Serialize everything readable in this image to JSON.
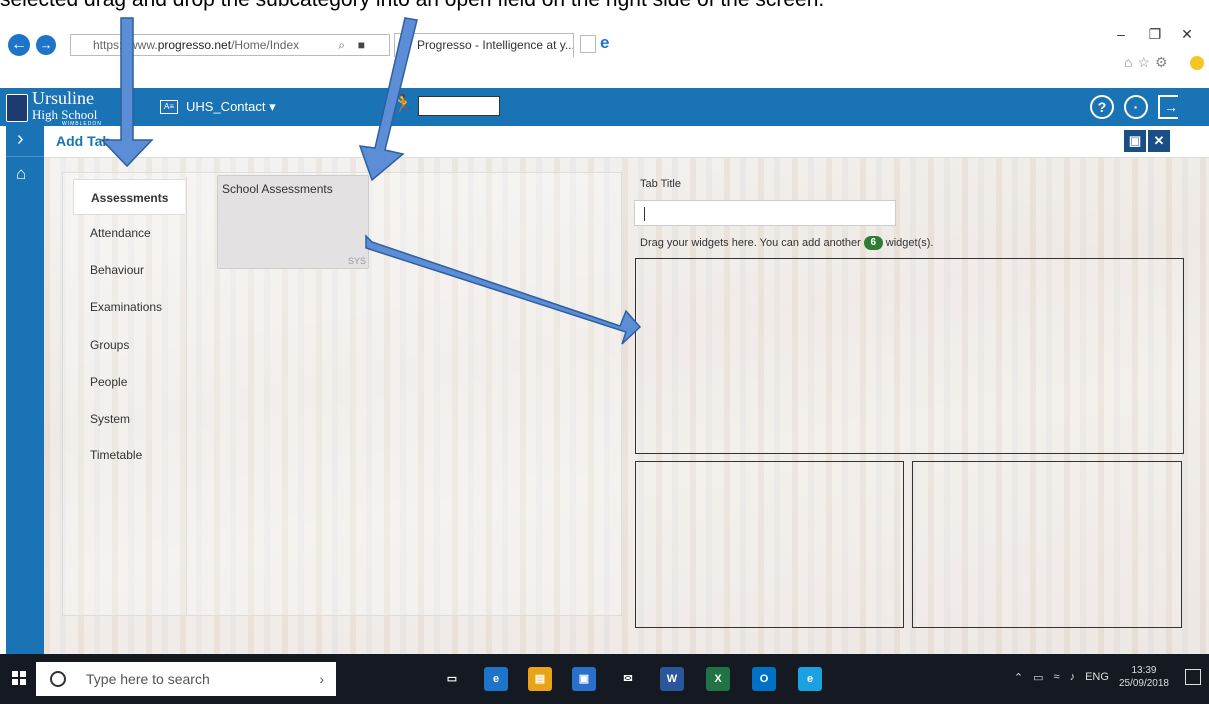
{
  "caption": "selected drag and drop the subcategory into an open field on the right side of the screen.",
  "browser": {
    "address_prefix": "https://www.",
    "address_domain": "progresso.net",
    "address_path": "/Home/Index",
    "search_glyph": "⌕",
    "tab_title": "Progresso - Intelligence at y...",
    "window_min": "–",
    "window_restore": "❐",
    "window_close": "✕"
  },
  "app": {
    "logo_line1": "Ursuline",
    "logo_line2": "High School",
    "logo_line3": "WIMBLEDON",
    "contact_menu": "UHS_Contact ▾",
    "page_title": "Add Tab",
    "help_icon": "?",
    "user_icon": "·",
    "logout_icon": "→"
  },
  "categories": [
    {
      "label": "Assessments",
      "active": true
    },
    {
      "label": "Attendance"
    },
    {
      "label": "Behaviour"
    },
    {
      "label": "Examinations"
    },
    {
      "label": "Groups"
    },
    {
      "label": "People"
    },
    {
      "label": "System"
    },
    {
      "label": "Timetable"
    }
  ],
  "widget": {
    "title": "School Assessments",
    "source": "SYS"
  },
  "form": {
    "tab_title_label": "Tab Title",
    "tab_title_value": "",
    "drag_hint_before": "Drag your widgets here. You can add another",
    "remaining_count": "6",
    "drag_hint_after": "widget(s)."
  },
  "taskbar": {
    "search_placeholder": "Type here to search",
    "apps": [
      {
        "name": "task-view",
        "glyph": "▭",
        "color": "#151a22"
      },
      {
        "name": "edge",
        "glyph": "e",
        "color": "#1e74c8"
      },
      {
        "name": "file-explorer",
        "glyph": "▤",
        "color": "#e8a317"
      },
      {
        "name": "store",
        "glyph": "▣",
        "color": "#2a6fc9"
      },
      {
        "name": "mail",
        "glyph": "✉",
        "color": "#151a22"
      },
      {
        "name": "word",
        "glyph": "W",
        "color": "#2b579a"
      },
      {
        "name": "excel",
        "glyph": "X",
        "color": "#217346"
      },
      {
        "name": "outlook",
        "glyph": "O",
        "color": "#0072c6"
      },
      {
        "name": "internet-explorer",
        "glyph": "e",
        "color": "#1ba1e2"
      }
    ],
    "tray_language": "ENG",
    "time": "13:39",
    "date": "25/09/2018"
  },
  "colors": {
    "brand_blue": "#1a73b5",
    "badge_green": "#2e7d32",
    "arrow_blue": "#5b8ed6"
  }
}
